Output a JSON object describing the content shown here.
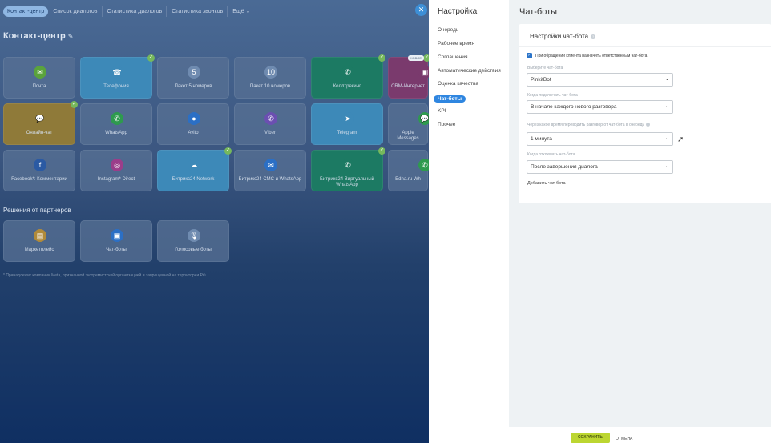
{
  "top_nav": [
    "Контакт-центр",
    "Список диалогов",
    "Статистика диалогов",
    "Статистика звонков",
    "Ещё ⌄"
  ],
  "bg_title": "Контакт-центр",
  "tiles": [
    {
      "label": "Почта",
      "icon": "mail-icon",
      "glyph": "✉",
      "color": "#5aa33c"
    },
    {
      "label": "Телефония",
      "icon": "phone-icon",
      "glyph": "☎",
      "color": "#3d89b8",
      "checked": true
    },
    {
      "label": "Пакет 5 номеров",
      "icon": "number-pack-icon",
      "glyph": "5",
      "color": "#6f8bb0"
    },
    {
      "label": "Пакет 10 номеров",
      "icon": "number-pack-icon",
      "glyph": "10",
      "color": "#6f8bb0"
    },
    {
      "label": "Коллтрекинг",
      "icon": "calltracking-icon",
      "glyph": "✆",
      "color": "#1c7a63",
      "checked": true
    },
    {
      "label": "CRM-Интернет",
      "icon": "crm-icon",
      "glyph": "▣",
      "color": "#7a3a6d",
      "checked": true,
      "badge": "НОВОЕ"
    },
    {
      "label": "Онлайн-чат",
      "icon": "chat-icon",
      "glyph": "💬",
      "color": "#8f7a39",
      "checked": true
    },
    {
      "label": "WhatsApp",
      "icon": "whatsapp-icon",
      "glyph": "✆",
      "color": "#2e9a4e"
    },
    {
      "label": "Avito",
      "icon": "avito-icon",
      "glyph": "●",
      "color": "#2b6fc5"
    },
    {
      "label": "Viber",
      "icon": "viber-icon",
      "glyph": "✆",
      "color": "#6b4fb1"
    },
    {
      "label": "Telegram",
      "icon": "telegram-icon",
      "glyph": "➤",
      "color": "#3d89b8"
    },
    {
      "label": "Apple Messages",
      "icon": "apple-messages-icon",
      "glyph": "💬",
      "color": "#2e9a4e"
    },
    {
      "label": "Facebook*: Комментарии",
      "icon": "facebook-icon",
      "glyph": "f",
      "color": "#2b5aa3"
    },
    {
      "label": "Instagram* Direct",
      "icon": "instagram-icon",
      "glyph": "◎",
      "color": "#9b3d8a"
    },
    {
      "label": "Битрикс24 Network",
      "icon": "cloud-icon",
      "glyph": "☁",
      "color": "#3d89b8",
      "checked": true
    },
    {
      "label": "Битрикс24 СМС и WhatsApp",
      "icon": "sms-icon",
      "glyph": "✉",
      "color": "#2b6fc5"
    },
    {
      "label": "Битрикс24 Виртуальный WhatsApp",
      "icon": "whatsapp-icon",
      "glyph": "✆",
      "color": "#1c7a63",
      "checked": true
    },
    {
      "label": "Edna.ru Wh",
      "icon": "edna-icon",
      "glyph": "✆",
      "color": "#2e9a4e"
    },
    {
      "label": "Маркетплейс",
      "icon": "marketplace-icon",
      "glyph": "▤",
      "color": "#b08a3a"
    },
    {
      "label": "Чат-боты",
      "icon": "bot-icon",
      "glyph": "▣",
      "color": "#2b6fc5"
    },
    {
      "label": "Голосовые боты",
      "icon": "microphone-icon",
      "glyph": "🎙",
      "color": "#6f8bb0"
    }
  ],
  "partners_title": "Решения от партнеров",
  "footer_note": "* Принадлежит компании Meta, признанной экстремистской организацией и запрещенной на территории РФ",
  "slider": {
    "side_title": "Настройка",
    "menu": [
      "Очередь",
      "Рабочее время",
      "Соглашения",
      "Автоматические действия",
      "Оценка качества",
      "Чат-боты",
      "KPI",
      "Прочее"
    ],
    "active_menu_index": 5,
    "page_title": "Чат-боты",
    "card_title": "Настройки чат-бота",
    "checkbox_label": "При обращении клиента назначить ответственным чат-бота",
    "checkbox_checked": true,
    "fields": [
      {
        "label": "Выберите чат-бота",
        "value": "PinkitBot"
      },
      {
        "label": "Когда подключать чат-бота",
        "value": "В начале каждого нового разговора"
      },
      {
        "label": "Через какое время переводить разговор от чат-бота в очередь",
        "value": "1 минута",
        "help": true
      },
      {
        "label": "Когда отключать чат-бота",
        "value": "После завершения диалога"
      }
    ],
    "add_link": "Добавить чат-бота",
    "save": "СОХРАНИТЬ",
    "cancel": "ОТМЕНА"
  }
}
